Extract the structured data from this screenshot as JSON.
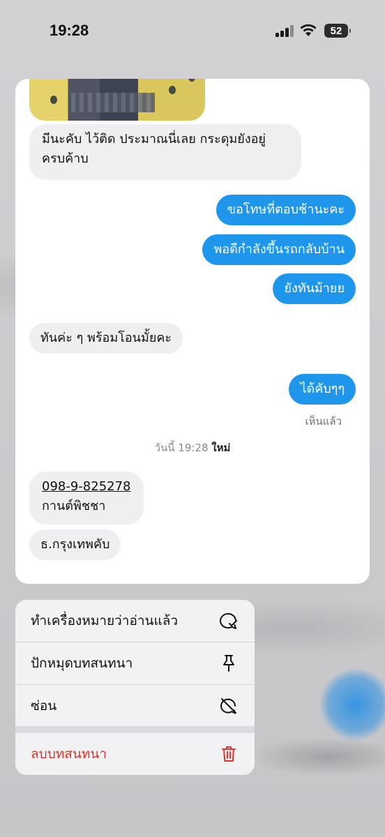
{
  "status_bar": {
    "time": "19:28",
    "battery": "52"
  },
  "chat": {
    "messages": [
      {
        "side": "in",
        "text_line1": "มีนะคับ ไว้ติด ประมาณนี่เลย กระดุมยังอยู่",
        "text_line2": "ครบค้าบ"
      },
      {
        "side": "out",
        "text": "ขอโทษที่ตอบช้านะคะ"
      },
      {
        "side": "out",
        "text": "พอดีกำลังขึ้นรถกลับบ้าน"
      },
      {
        "side": "out",
        "text": "ยังทันม้ายย"
      },
      {
        "side": "in",
        "text": "ทันค่ะ ๆ พร้อมโอนมั้ยคะ"
      },
      {
        "side": "out",
        "text": "ได้คับๆๆ"
      },
      {
        "side": "in",
        "phone": "098-9-825278",
        "name": "กานต์พิชชา"
      },
      {
        "side": "in",
        "text": "ธ.กรุงเทพคับ"
      }
    ],
    "seen_label": "เห็นแล้ว",
    "divider_time": "วันนี้ 19:28",
    "divider_new": "ใหม่"
  },
  "context_menu": {
    "items": [
      {
        "label": "ทำเครื่องหมายว่าอ่านแล้ว",
        "icon": "mark-read-icon"
      },
      {
        "label": "ปักหมุดบทสนทนา",
        "icon": "pin-icon"
      },
      {
        "label": "ซ่อน",
        "icon": "hide-icon"
      },
      {
        "label": "ลบบทสนทนา",
        "icon": "trash-icon",
        "destructive": true
      }
    ],
    "destructive_color": "#e0342b"
  },
  "colors": {
    "outgoing_bubble": "#1e96ec",
    "incoming_bubble": "#efeff2"
  }
}
